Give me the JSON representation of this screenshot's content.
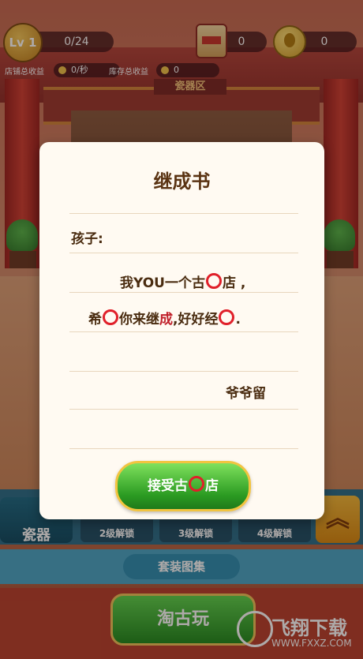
{
  "hud": {
    "level": "Lv 1",
    "progress": "0/24",
    "scroll_count": "0",
    "coin_count": "0",
    "shop_income_label": "店铺总收益",
    "shop_income_value": "0/秒",
    "stock_income_label": "库存总收益",
    "stock_income_value": "0"
  },
  "scene": {
    "area_sign": "瓷器区"
  },
  "modal": {
    "title": "继成书",
    "greeting": "孩子:",
    "line1_a": "我YOU一个古",
    "line1_b": "店 ,",
    "line2_a": "希",
    "line2_b": "你来继",
    "line2_c": "成",
    "line2_d": ",好好经",
    "line2_e": ".",
    "signature": "爷爷留",
    "accept_a": "接受古",
    "accept_b": "店"
  },
  "bottom": {
    "porcelain_tab": "瓷器",
    "unlock_tabs": [
      "2级解锁",
      "3级解锁",
      "4级解锁"
    ],
    "set_gallery": "套装图集",
    "main_button": "淘古玩"
  },
  "watermark": {
    "title": "飞翔下载",
    "url": "WWW.FXXZ.COM"
  }
}
